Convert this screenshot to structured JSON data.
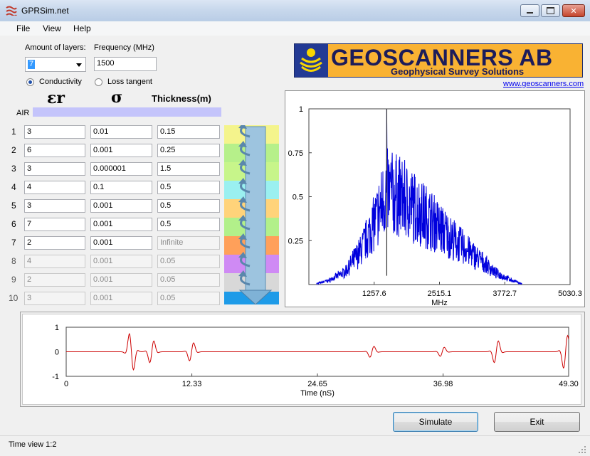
{
  "window": {
    "title": "GPRSim.net",
    "min_label": "0",
    "max_label": "□",
    "close_label": "x"
  },
  "menu": {
    "items": [
      "File",
      "View",
      "Help"
    ]
  },
  "settings": {
    "layers_label": "Amount of layers:",
    "layers_value": "7",
    "frequency_label": "Frequency (MHz)",
    "frequency_value": "1500",
    "conductivity_label": "Conductivity",
    "loss_tangent_label": "Loss tangent",
    "conductivity_selected": true
  },
  "table": {
    "headers": {
      "epsilon": "εr",
      "sigma": "σ",
      "thickness": "Thickness(m)"
    },
    "air_label": "AIR",
    "rows": [
      {
        "n": "1",
        "eps": "3",
        "sigma": "0.01",
        "thick": "0.15",
        "enabled": true
      },
      {
        "n": "2",
        "eps": "6",
        "sigma": "0.001",
        "thick": "0.25",
        "enabled": true
      },
      {
        "n": "3",
        "eps": "3",
        "sigma": "0.000001",
        "thick": "1.5",
        "enabled": true
      },
      {
        "n": "4",
        "eps": "4",
        "sigma": "0.1",
        "thick": "0.5",
        "enabled": true
      },
      {
        "n": "5",
        "eps": "3",
        "sigma": "0.001",
        "thick": "0.5",
        "enabled": true
      },
      {
        "n": "6",
        "eps": "7",
        "sigma": "0.001",
        "thick": "0.5",
        "enabled": true
      },
      {
        "n": "7",
        "eps": "2",
        "sigma": "0.001",
        "thick": "Infinite",
        "enabled": true,
        "thick_disabled": true
      },
      {
        "n": "8",
        "eps": "4",
        "sigma": "0.001",
        "thick": "0.05",
        "enabled": false
      },
      {
        "n": "9",
        "eps": "2",
        "sigma": "0.001",
        "thick": "0.05",
        "enabled": false
      },
      {
        "n": "10",
        "eps": "3",
        "sigma": "0.001",
        "thick": "0.05",
        "enabled": false
      }
    ],
    "layer_colors": [
      "#f4f48c",
      "#b6f08a",
      "#c7f58a",
      "#9af0f0",
      "#ffd37a",
      "#b2f08a",
      "#ffa05a",
      "#cf8af4",
      "#d8d8d8",
      "#1e9be8"
    ]
  },
  "logo": {
    "name": "GEOSCANNERS AB",
    "tagline": "Geophysical Survey Solutions",
    "url": "www.geoscanners.com"
  },
  "chart_data": [
    {
      "type": "line",
      "name": "frequency-spectrum",
      "xlabel": "MHz",
      "xlim": [
        0,
        5030.3
      ],
      "ylim": [
        0,
        1
      ],
      "xticks": [
        "1257.6",
        "2515.1",
        "3772.7",
        "5030.3"
      ],
      "yticks": [
        "1",
        "0.75",
        "0.5",
        "0.25"
      ],
      "color": "#0000dd",
      "envelope": {
        "x": [
          150,
          400,
          700,
          1000,
          1300,
          1500,
          1800,
          2100,
          2400,
          2700,
          3000,
          3300,
          3600,
          3900,
          4100
        ],
        "y": [
          0.0,
          0.03,
          0.1,
          0.28,
          0.55,
          0.78,
          0.72,
          0.62,
          0.52,
          0.4,
          0.3,
          0.2,
          0.09,
          0.03,
          0.0
        ]
      },
      "peak": {
        "x": 1500,
        "y": 1.0
      }
    },
    {
      "type": "line",
      "name": "time-trace",
      "xlabel": "Time (nS)",
      "xlim": [
        0,
        49.3
      ],
      "ylim": [
        -1,
        1
      ],
      "xticks": [
        "0",
        "12.33",
        "24.65",
        "36.98",
        "49.30"
      ],
      "yticks": [
        "1",
        "0",
        "-1"
      ],
      "color": "#cc0000",
      "reflections": [
        {
          "t": 6.4,
          "amp": -1.0
        },
        {
          "t": 8.4,
          "amp": 0.6
        },
        {
          "t": 12.3,
          "amp": 0.5
        },
        {
          "t": 30.0,
          "amp": 0.3
        },
        {
          "t": 36.9,
          "amp": 0.25
        },
        {
          "t": 42.2,
          "amp": 0.6
        },
        {
          "t": 49.0,
          "amp": 0.9
        }
      ]
    }
  ],
  "buttons": {
    "simulate": "Simulate",
    "exit": "Exit"
  },
  "status": {
    "text": "Time view 1:2"
  }
}
